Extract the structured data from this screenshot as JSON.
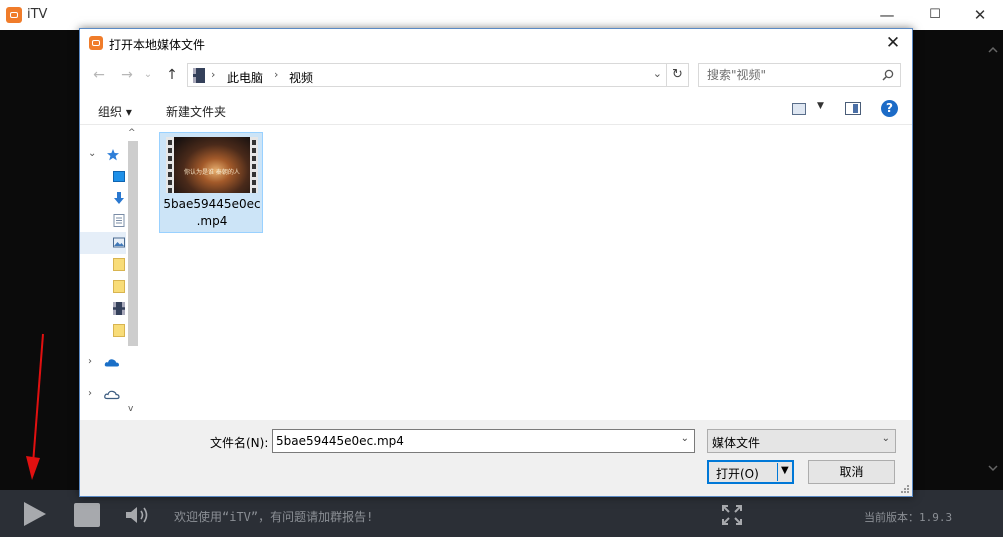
{
  "app": {
    "title": "iTV",
    "window_controls": {
      "minimize": "—",
      "maximize": "☐",
      "close": "✕"
    }
  },
  "controlbar": {
    "welcome": "欢迎使用“iTV”，有问题请加群报告!",
    "version": "当前版本：1.9.3"
  },
  "dialog": {
    "title": "打开本地媒体文件",
    "close": "✕",
    "nav": {
      "back": "←",
      "forward": "→",
      "recent": "⌄",
      "up": "↑"
    },
    "address": {
      "crumbs": [
        "此电脑",
        "视频"
      ],
      "separator": "›",
      "dropdown": "⌄",
      "refresh": "↻"
    },
    "search": {
      "placeholder": "搜索\"视频\""
    },
    "toolbar": {
      "organize": "组织 ▾",
      "new_folder": "新建文件夹",
      "view_drop": "▼",
      "help": "?"
    },
    "tree": {
      "chevrons": [
        "⌄",
        "›",
        "›"
      ],
      "scroll_up": "^",
      "scroll_down": "v"
    },
    "files": [
      {
        "name_line1": "5bae59445e0ec",
        "name_line2": ".mp4",
        "thumb_caption": "你认为是谁 秦朝的人"
      }
    ],
    "bottom": {
      "filename_label": "文件名(N):",
      "filename_value": "5bae59445e0ec.mp4",
      "filter": "媒体文件",
      "open": "打开(O)",
      "cancel": "取消",
      "caret": "⌄",
      "open_caret": "▼"
    }
  },
  "colors": {
    "accent": "#0078d7",
    "brand": "#f07c2a",
    "annotation": "#e01010"
  }
}
